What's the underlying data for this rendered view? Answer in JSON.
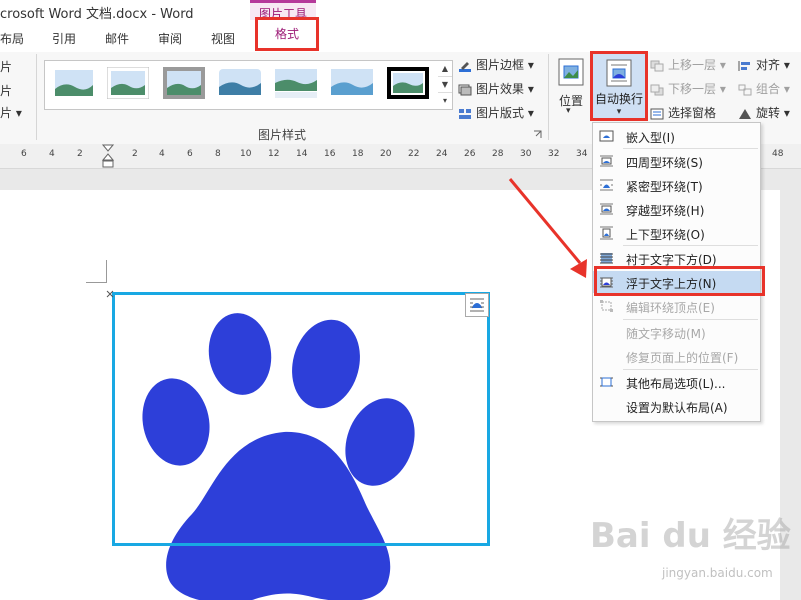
{
  "window": {
    "title": "crosoft Word 文档.docx - Word",
    "context_label": "图片工具"
  },
  "tabs": [
    "布局",
    "引用",
    "邮件",
    "审阅",
    "视图",
    "格式"
  ],
  "ribbon": {
    "left_cut_items": [
      "片",
      "片",
      "片 ▾"
    ],
    "picture_border": "图片边框 ▾",
    "picture_effects": "图片效果 ▾",
    "picture_layout": "图片版式 ▾",
    "group_label": "图片样式",
    "position": "位置",
    "wrap_text": "自动换行",
    "bring_forward": "上移一层 ▾",
    "send_backward": "下移一层 ▾",
    "selection_pane": "选择窗格",
    "align": "对齐 ▾",
    "group": "组合 ▾",
    "rotate": "旋转 ▾"
  },
  "ruler": {
    "ticks": [
      "6",
      "4",
      "2",
      "2",
      "4",
      "6",
      "8",
      "10",
      "12",
      "14",
      "16",
      "18",
      "20",
      "22",
      "24",
      "26",
      "28",
      "30",
      "32",
      "34",
      "48"
    ]
  },
  "menu": {
    "items": [
      {
        "label": "嵌入型(I)",
        "disabled": false,
        "selected": false
      },
      {
        "label": "四周型环绕(S)",
        "disabled": false,
        "selected": false
      },
      {
        "label": "紧密型环绕(T)",
        "disabled": false,
        "selected": false
      },
      {
        "label": "穿越型环绕(H)",
        "disabled": false,
        "selected": false
      },
      {
        "label": "上下型环绕(O)",
        "disabled": false,
        "selected": false
      },
      {
        "label": "衬于文字下方(D)",
        "disabled": false,
        "selected": false
      },
      {
        "label": "浮于文字上方(N)",
        "disabled": false,
        "selected": true
      },
      {
        "label": "编辑环绕顶点(E)",
        "disabled": true,
        "selected": false
      },
      {
        "label": "随文字移动(M)",
        "disabled": true,
        "selected": false
      },
      {
        "label": "修复页面上的位置(F)",
        "disabled": true,
        "selected": false
      },
      {
        "label": "其他布局选项(L)...",
        "disabled": false,
        "selected": false
      },
      {
        "label": "设置为默认布局(A)",
        "disabled": false,
        "selected": false
      }
    ]
  },
  "watermark": {
    "brand": "Bai du 经验",
    "url": "jingyan.baidu.com"
  },
  "colors": {
    "accent_pink": "#9c1a76",
    "highlight_red": "#e8332a",
    "frame_blue": "#18a8e3",
    "paw_blue": "#2d3fd9"
  }
}
